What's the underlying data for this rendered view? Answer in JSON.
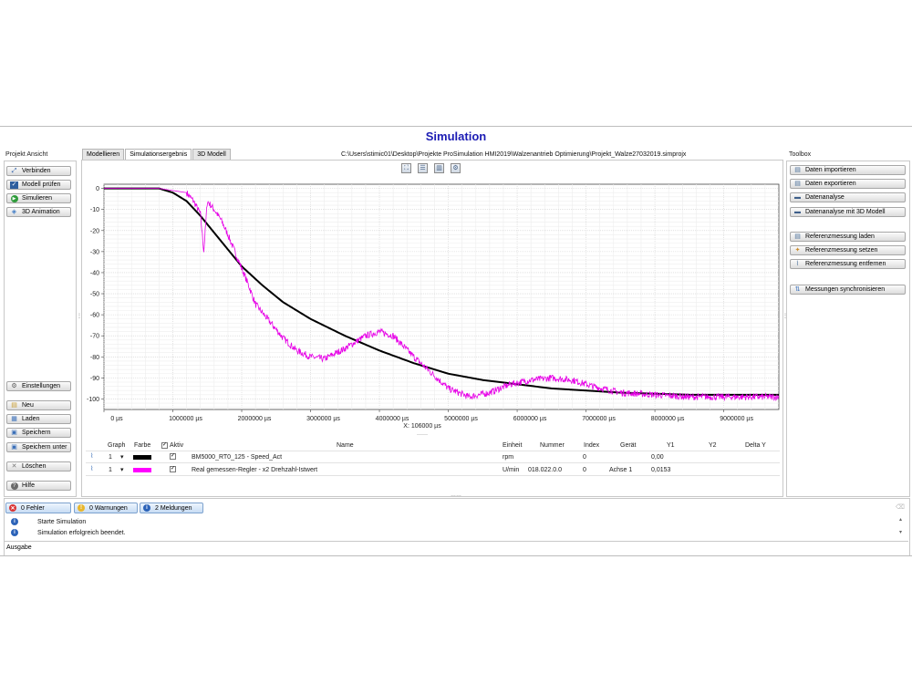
{
  "app_title": "Simulation",
  "left_panel": {
    "title": "Projekt Ansicht",
    "top_buttons": [
      {
        "label": "Verbinden",
        "icon": "connect-icon"
      },
      {
        "label": "Modell prüfen",
        "icon": "check-model-icon"
      },
      {
        "label": "Simulieren",
        "icon": "play-icon"
      },
      {
        "label": "3D Animation",
        "icon": "animation-icon"
      }
    ],
    "bottom_buttons": [
      {
        "label": "Einstellungen",
        "icon": "gear-icon"
      },
      {
        "label": "Neu",
        "icon": "new-file-icon"
      },
      {
        "label": "Laden",
        "icon": "open-icon"
      },
      {
        "label": "Speichern",
        "icon": "save-icon"
      },
      {
        "label": "Speichern unter",
        "icon": "save-as-icon"
      },
      {
        "label": "Löschen",
        "icon": "delete-icon"
      },
      {
        "label": "Hilfe",
        "icon": "help-icon"
      }
    ]
  },
  "tabs": [
    {
      "label": "Modellieren",
      "active": false
    },
    {
      "label": "Simulationsergebnis",
      "active": true
    },
    {
      "label": "3D Modell",
      "active": false
    }
  ],
  "project_path": "C:\\Users\\stimic01\\Desktop\\Projekte ProSimulation HMI2019\\Walzenantrieb Optimierung\\Projekt_Walze27032019.simprojx",
  "plot_tools": [
    "fit-icon",
    "split-horizontal-icon",
    "split-vertical-icon",
    "settings-icon"
  ],
  "chart_data": {
    "type": "line",
    "xlim": [
      0,
      9800000
    ],
    "ylim": [
      -105,
      2
    ],
    "x_ticks": [
      "0 µs",
      "1000000 µs",
      "2000000 µs",
      "3000000 µs",
      "4000000 µs",
      "5000000 µs",
      "6000000 µs",
      "7000000 µs",
      "8000000 µs",
      "9000000 µs"
    ],
    "y_ticks": [
      "0",
      "-10",
      "-20",
      "-30",
      "-40",
      "-50",
      "-60",
      "-70",
      "-80",
      "-90",
      "-100"
    ],
    "cursor_readout": "X: 106000 µs",
    "grid": true,
    "series": [
      {
        "name": "BM5000_RT0_125 - Speed_Act",
        "color": "#000000",
        "x": [
          0,
          400000,
          800000,
          1000000,
          1200000,
          1400000,
          1600000,
          1800000,
          2000000,
          2300000,
          2600000,
          3000000,
          3500000,
          4000000,
          4500000,
          5000000,
          5500000,
          6000000,
          6500000,
          7000000,
          7500000,
          8000000,
          8500000,
          9000000,
          9800000
        ],
        "y": [
          0,
          0,
          0,
          -2,
          -6,
          -13,
          -21,
          -29,
          -37,
          -46,
          -54,
          -62,
          -70,
          -77,
          -83,
          -88,
          -91,
          -93,
          -95,
          -96,
          -97,
          -97.5,
          -98,
          -98,
          -98
        ]
      },
      {
        "name": "Real gemessen-Regler - x2 Drehzahl-Istwert",
        "color": "#e600e6",
        "x": [
          0,
          400000,
          800000,
          1000000,
          1200000,
          1300000,
          1400000,
          1450000,
          1500000,
          1600000,
          1700000,
          1800000,
          1900000,
          2000000,
          2100000,
          2200000,
          2400000,
          2600000,
          2800000,
          3000000,
          3200000,
          3500000,
          3800000,
          4000000,
          4200000,
          4500000,
          4800000,
          5000000,
          5300000,
          5600000,
          5900000,
          6200000,
          6500000,
          6800000,
          7100000,
          7500000,
          8000000,
          8500000,
          9000000,
          9800000
        ],
        "y": [
          0,
          0,
          0,
          -1,
          -2,
          -6,
          -12,
          -30,
          -6,
          -10,
          -15,
          -22,
          -30,
          -38,
          -46,
          -55,
          -63,
          -71,
          -77,
          -80,
          -81,
          -76,
          -70,
          -68,
          -70,
          -80,
          -89,
          -95,
          -99,
          -97,
          -93,
          -91,
          -90,
          -91,
          -94,
          -97,
          -98,
          -99,
          -99,
          -99
        ]
      }
    ]
  },
  "table": {
    "headers": [
      "Graph",
      "Farbe",
      "Aktiv",
      "Name",
      "Einheit",
      "Nummer",
      "Index",
      "Gerät",
      "Y1",
      "Y2",
      "Delta Y"
    ],
    "rows": [
      {
        "graph": "1",
        "color": "#000000",
        "active": true,
        "name": "BM5000_RT0_125 - Speed_Act",
        "unit": "rpm",
        "number": "",
        "index": "0",
        "device": "",
        "y1": "0,00",
        "y2": "",
        "delta": ""
      },
      {
        "graph": "1",
        "color": "#ff00ff",
        "active": true,
        "name": "Real gemessen-Regler - x2 Drehzahl-Istwert",
        "unit": "U/min",
        "number": "018.022.0.0",
        "index": "0",
        "device": "Achse 1",
        "y1": "0,0153",
        "y2": "",
        "delta": ""
      }
    ]
  },
  "toolbox": {
    "title": "Toolbox",
    "groups": [
      [
        {
          "label": "Daten importieren",
          "icon": "import-icon"
        },
        {
          "label": "Daten exportieren",
          "icon": "export-icon"
        },
        {
          "label": "Datenanalyse",
          "icon": "analysis-icon"
        },
        {
          "label": "Datenanalyse mit 3D Modell",
          "icon": "analysis-3d-icon"
        }
      ],
      [
        {
          "label": "Referenzmessung laden",
          "icon": "load-reference-icon"
        },
        {
          "label": "Referenzmessung setzen",
          "icon": "set-reference-icon"
        },
        {
          "label": "Referenzmessung entfernen",
          "icon": "remove-reference-icon"
        }
      ],
      [
        {
          "label": "Messungen synchronisieren",
          "icon": "sync-icon"
        }
      ]
    ]
  },
  "messages": {
    "errors": "0 Fehler",
    "warnings": "0 Warnungen",
    "notices": "2 Meldungen",
    "log": [
      "Starte Simulation",
      "Simulation erfolgreich beendet."
    ],
    "output_tab": "Ausgabe"
  }
}
